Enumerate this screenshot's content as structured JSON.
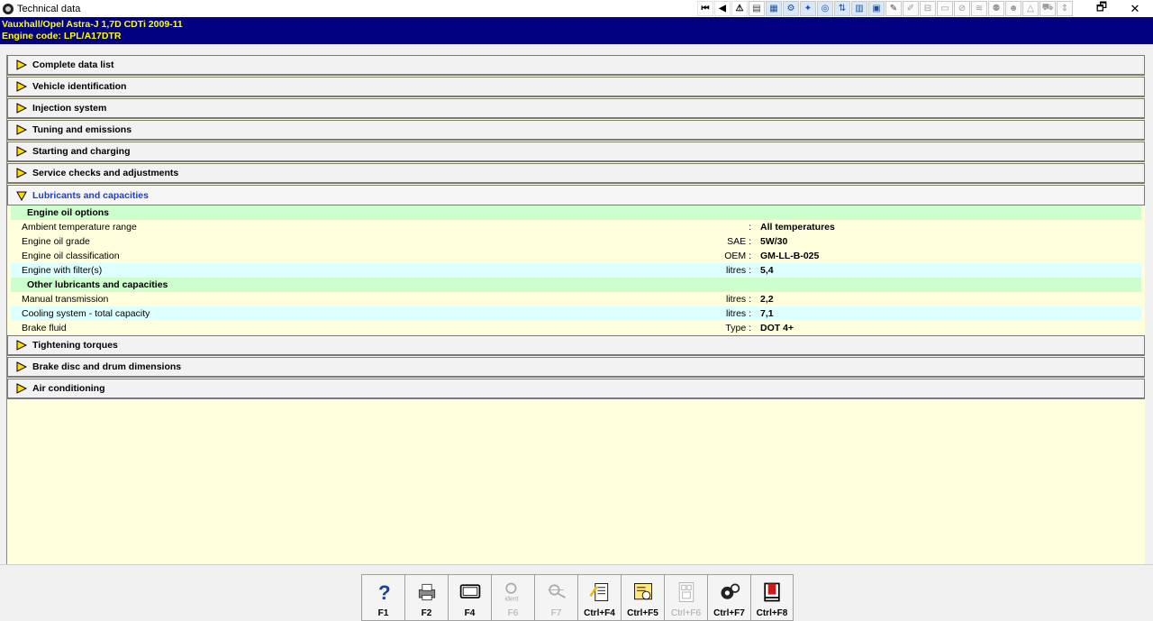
{
  "window": {
    "title": "Technical data",
    "restore_glyph": "🗗",
    "close_glyph": "✕"
  },
  "toolbar": {
    "icons": [
      {
        "name": "first-page-icon",
        "glyph": "⏮",
        "style": "dark"
      },
      {
        "name": "back-icon",
        "glyph": "◀",
        "style": "dark"
      },
      {
        "name": "warning-icon",
        "glyph": "⚠",
        "style": "dark"
      },
      {
        "name": "document-icon",
        "glyph": "▤",
        "style": "plain"
      },
      {
        "name": "diagram-icon",
        "glyph": "▦",
        "style": "colored"
      },
      {
        "name": "engine-icon",
        "glyph": "⚙",
        "style": "colored"
      },
      {
        "name": "maintenance-icon",
        "glyph": "✦",
        "style": "colored"
      },
      {
        "name": "tyre-icon",
        "glyph": "◎",
        "style": "colored"
      },
      {
        "name": "lift-icon",
        "glyph": "⇅",
        "style": "colored"
      },
      {
        "name": "chart-icon",
        "glyph": "▥",
        "style": "colored"
      },
      {
        "name": "calendar-icon",
        "glyph": "▣",
        "style": "colored"
      },
      {
        "name": "tool-icon",
        "glyph": "✎",
        "style": "plain"
      },
      {
        "name": "brush-icon",
        "glyph": "✐",
        "style": "faded"
      },
      {
        "name": "fuse-icon",
        "glyph": "⊟",
        "style": "faded"
      },
      {
        "name": "lamp-icon",
        "glyph": "▭",
        "style": "faded"
      },
      {
        "name": "steering-icon",
        "glyph": "⊘",
        "style": "faded"
      },
      {
        "name": "wiper-icon",
        "glyph": "≋",
        "style": "faded"
      },
      {
        "name": "airbag-icon",
        "glyph": "⚉",
        "style": "faded"
      },
      {
        "name": "person-icon",
        "glyph": "☻",
        "style": "faded"
      },
      {
        "name": "hazard-icon",
        "glyph": "△",
        "style": "faded"
      },
      {
        "name": "car-icon",
        "glyph": "⛟",
        "style": "faded"
      },
      {
        "name": "resize-icon",
        "glyph": "⇕",
        "style": "faded"
      }
    ]
  },
  "vehicle": {
    "line1": "Vauxhall/Opel   Astra-J  1,7D CDTi 2009-11",
    "line2": "Engine code: LPL/A17DTR"
  },
  "sections": [
    {
      "label": "Complete data list"
    },
    {
      "label": "Vehicle identification"
    },
    {
      "label": "Injection system"
    },
    {
      "label": "Tuning and emissions"
    },
    {
      "label": "Starting and charging"
    },
    {
      "label": "Service checks and adjustments"
    }
  ],
  "open_section": {
    "label": "Lubricants and capacities",
    "groups": [
      {
        "title": "Engine oil options",
        "rows": [
          {
            "label": "Ambient temperature range",
            "unit": ":",
            "value": "All temperatures",
            "color": "yellow"
          },
          {
            "label": "Engine oil grade",
            "unit": "SAE :",
            "value": "5W/30",
            "color": "yellow"
          },
          {
            "label": "Engine oil classification",
            "unit": "OEM :",
            "value": "GM-LL-B-025",
            "color": "yellow"
          },
          {
            "label": "Engine with filter(s)",
            "unit": "litres :",
            "value": "5,4",
            "color": "cyan"
          }
        ]
      },
      {
        "title": "Other lubricants and capacities",
        "rows": [
          {
            "label": "Manual transmission",
            "unit": "litres :",
            "value": "2,2",
            "color": "yellow"
          },
          {
            "label": "Cooling system - total capacity",
            "unit": "litres :",
            "value": "7,1",
            "color": "cyan"
          },
          {
            "label": "Brake fluid",
            "unit": "Type :",
            "value": "DOT 4+",
            "color": "yellow"
          }
        ]
      }
    ]
  },
  "sections_after": [
    {
      "label": "Tightening torques"
    },
    {
      "label": "Brake disc and drum dimensions"
    },
    {
      "label": "Air conditioning"
    }
  ],
  "fkeys": [
    {
      "name": "help-button",
      "icon": "help-icon",
      "label": "F1",
      "enabled": true
    },
    {
      "name": "print-button",
      "icon": "printer-icon",
      "label": "F2",
      "enabled": true
    },
    {
      "name": "screen-button",
      "icon": "monitor-icon",
      "label": "F4",
      "enabled": true
    },
    {
      "name": "ident-button",
      "icon": "ident-icon",
      "label": "F6",
      "enabled": false
    },
    {
      "name": "search-button",
      "icon": "magnifier-icon",
      "label": "F7",
      "enabled": false
    },
    {
      "name": "notes-button",
      "icon": "notepad-icon",
      "label": "Ctrl+F4",
      "enabled": true
    },
    {
      "name": "data-button",
      "icon": "gauge-icon",
      "label": "Ctrl+F5",
      "enabled": true
    },
    {
      "name": "compare-button",
      "icon": "compare-icon",
      "label": "Ctrl+F6",
      "enabled": false
    },
    {
      "name": "settings-button",
      "icon": "cogs-icon",
      "label": "Ctrl+F7",
      "enabled": true
    },
    {
      "name": "exit-button",
      "icon": "exit-icon",
      "label": "Ctrl+F8",
      "enabled": true
    }
  ],
  "colors": {
    "header_bg": "#000080",
    "header_text": "#ffff00",
    "content_bg": "#ffffdd",
    "group_bg": "#ccffcc",
    "cyan_row": "#ddffff",
    "open_section_text": "#1a3dd6"
  }
}
